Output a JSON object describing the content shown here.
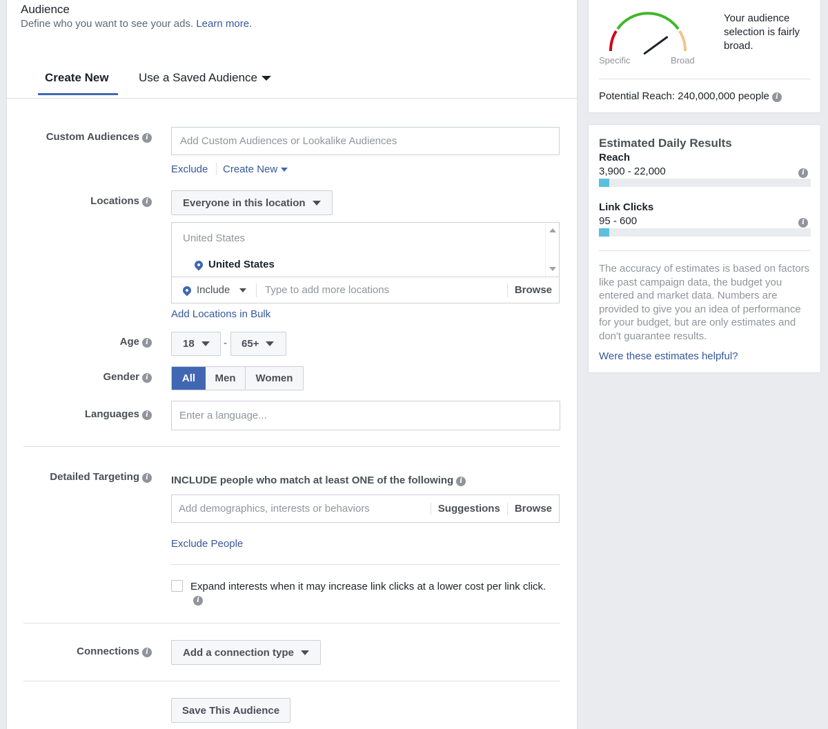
{
  "header": {
    "title": "Audience",
    "subtitle": "Define who you want to see your ads.",
    "learn_more": "Learn more."
  },
  "tabs": [
    {
      "label": "Create New",
      "active": true
    },
    {
      "label": "Use a Saved Audience",
      "active": false
    }
  ],
  "custom_audiences": {
    "label": "Custom Audiences",
    "placeholder": "Add Custom Audiences or Lookalike Audiences",
    "exclude": "Exclude",
    "create_new": "Create New"
  },
  "locations": {
    "label": "Locations",
    "dropdown": "Everyone in this location",
    "group": "United States",
    "selected": "United States",
    "include": "Include",
    "placeholder": "Type to add more locations",
    "browse": "Browse",
    "bulk": "Add Locations in Bulk"
  },
  "age": {
    "label": "Age",
    "min": "18",
    "max": "65+",
    "dash": "-"
  },
  "gender": {
    "label": "Gender",
    "options": [
      "All",
      "Men",
      "Women"
    ],
    "selected": "All"
  },
  "languages": {
    "label": "Languages",
    "placeholder": "Enter a language..."
  },
  "detailed_targeting": {
    "label": "Detailed Targeting",
    "include_text": "INCLUDE people who match at least ONE of the following",
    "placeholder": "Add demographics, interests or behaviors",
    "suggestions": "Suggestions",
    "browse": "Browse",
    "exclude": "Exclude People",
    "expand_text": "Expand interests when it may increase link clicks at a lower cost per link click.",
    "expand_checked": false
  },
  "connections": {
    "label": "Connections",
    "dropdown": "Add a connection type"
  },
  "save_button": "Save This Audience",
  "audience_meter": {
    "specific": "Specific",
    "broad": "Broad",
    "description": "Your audience selection is fairly broad.",
    "potential_reach": "Potential Reach: 240,000,000 people",
    "needle_level": 0.8
  },
  "estimates": {
    "title": "Estimated Daily Results",
    "reach_label": "Reach",
    "reach_value": "3,900 - 22,000",
    "reach_fill": 0.05,
    "clicks_label": "Link Clicks",
    "clicks_value": "95 - 600",
    "clicks_fill": 0.05,
    "disclaimer": "The accuracy of estimates is based on factors like past campaign data, the budget you entered and market data. Numbers are provided to give you an idea of performance for your budget, but are only estimates and don't guarantee results.",
    "helpful": "Were these estimates helpful?"
  },
  "colors": {
    "accent": "#4267b2",
    "link": "#365899",
    "bar_fill": "#5bc0de",
    "gauge_red": "#d0021b",
    "gauge_green": "#42b72a",
    "gauge_orange": "#f5a623"
  }
}
